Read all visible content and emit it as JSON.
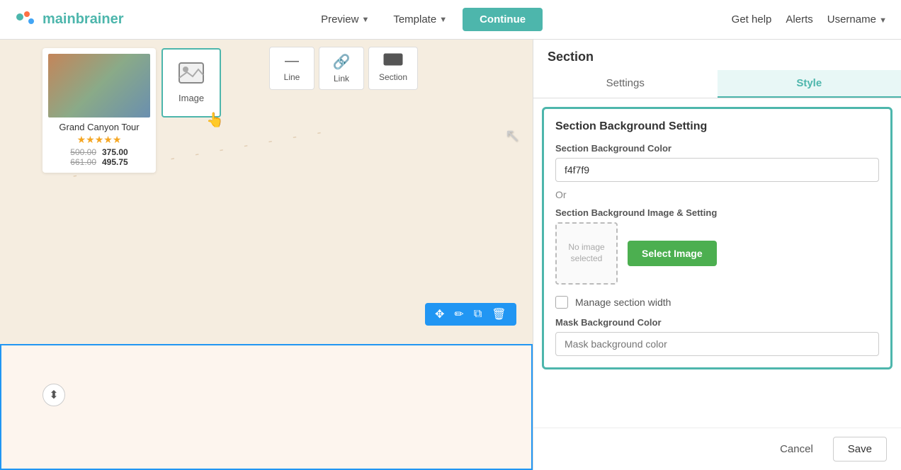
{
  "header": {
    "logo_brand": "main",
    "logo_accent": "brainer",
    "preview_label": "Preview",
    "template_label": "Template",
    "continue_label": "Continue",
    "get_help_label": "Get help",
    "alerts_label": "Alerts",
    "username_label": "Username"
  },
  "toolbar": {
    "items": [
      {
        "id": "line",
        "label": "Line",
        "icon": "—"
      },
      {
        "id": "link",
        "label": "Link",
        "icon": "🔗"
      },
      {
        "id": "section",
        "label": "Section",
        "icon": "▬"
      }
    ],
    "image_component": {
      "label": "Image",
      "icon": "🖼"
    }
  },
  "product": {
    "name": "Grand Canyon Tour",
    "stars": "★★★★★",
    "price_old": "500.00",
    "price_new": "375.00",
    "price_old2": "661.00",
    "price_new2": "495.75"
  },
  "right_panel": {
    "section_title": "Section",
    "tab_settings": "Settings",
    "tab_style": "Style",
    "settings_block_title": "Section Background Setting",
    "bg_color_label": "Section Background Color",
    "bg_color_value": "f4f7f9",
    "or_text": "Or",
    "bg_image_label": "Section Background Image & Setting",
    "no_image_text": "No image selected",
    "select_image_btn": "Select Image",
    "manage_width_label": "Manage section width",
    "mask_color_label": "Mask Background Color",
    "mask_color_placeholder": "Mask background color",
    "cancel_label": "Cancel",
    "save_label": "Save"
  },
  "section_toolbar": {
    "move_icon": "✥",
    "edit_icon": "✏",
    "copy_icon": "⧉",
    "delete_icon": "🗑"
  }
}
